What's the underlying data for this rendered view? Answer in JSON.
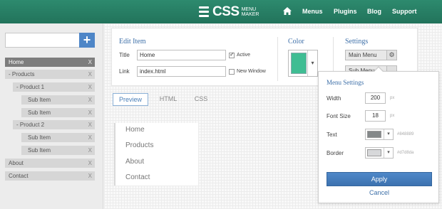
{
  "header": {
    "logo_main": "CSS",
    "logo_sub_1": "MENU",
    "logo_sub_2": "MAKER",
    "nav": [
      "Menus",
      "Plugins",
      "Blog",
      "Support"
    ],
    "home_icon": "home-icon"
  },
  "sidebar": {
    "search_value": "",
    "add_label": "+",
    "items": [
      {
        "label": "Home",
        "active": true,
        "remove": "X"
      },
      {
        "label": "- Products",
        "remove": "X"
      },
      {
        "label": "- Product 1",
        "remove": "X"
      },
      {
        "label": "Sub Item",
        "remove": "X"
      },
      {
        "label": "Sub Item",
        "remove": "X"
      },
      {
        "label": "- Product 2",
        "remove": "X"
      },
      {
        "label": "Sub Item",
        "remove": "X"
      },
      {
        "label": "Sub Item",
        "remove": "X"
      },
      {
        "label": "About",
        "remove": "X"
      },
      {
        "label": "Contact",
        "remove": "X"
      }
    ]
  },
  "edit_item": {
    "title": "Edit Item",
    "title_label": "Title",
    "title_value": "Home",
    "active_label": "Active",
    "active_checked": true,
    "link_label": "Link",
    "link_value": "index.html",
    "new_window_label": "New Window",
    "new_window_checked": false
  },
  "color": {
    "title": "Color",
    "value": "#3fbd93",
    "dropdown_icon": "chevron-down-icon"
  },
  "settings": {
    "title": "Settings",
    "main_menu": "Main Menu",
    "sub_menu": "Sub Menu",
    "gear_icon": "gear-icon"
  },
  "tabs": [
    {
      "label": "Preview",
      "active": true
    },
    {
      "label": "HTML"
    },
    {
      "label": "CSS"
    }
  ],
  "preview": {
    "items": [
      "Home",
      "Products",
      "About",
      "Contact"
    ]
  },
  "menu_settings": {
    "title": "Menu Settings",
    "width_label": "Width",
    "width_value": "200",
    "width_unit": "px",
    "font_size_label": "Font Size",
    "font_size_value": "18",
    "font_size_unit": "px",
    "text_label": "Text",
    "text_color": "#848889",
    "text_hex": "#848889",
    "border_label": "Border",
    "border_color": "#d7d8da",
    "border_hex": "#d7d8da",
    "apply_label": "Apply",
    "cancel_label": "Cancel"
  }
}
